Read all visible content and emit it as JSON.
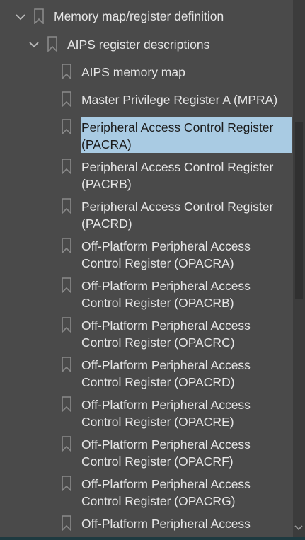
{
  "tree": {
    "level0": {
      "label": "Memory map/register definition",
      "icon": "bookmark-icon",
      "expand_icon": "chevron-down-icon"
    },
    "level1": {
      "label": "AIPS register descriptions",
      "icon": "bookmark-icon",
      "expand_icon": "chevron-down-icon"
    },
    "items": [
      {
        "line1": "AIPS memory map",
        "line2": ""
      },
      {
        "line1": "Master Privilege Register A (MPRA)",
        "line2": ""
      },
      {
        "line1": "Peripheral Access Control Register",
        "line2": "(PACRA)",
        "selected": true
      },
      {
        "line1": "Peripheral Access Control Register",
        "line2": "(PACRB)"
      },
      {
        "line1": "Peripheral Access Control Register",
        "line2": "(PACRD)"
      },
      {
        "line1": "Off-Platform Peripheral Access",
        "line2": "Control Register (OPACRA)"
      },
      {
        "line1": "Off-Platform Peripheral Access",
        "line2": "Control Register (OPACRB)"
      },
      {
        "line1": "Off-Platform Peripheral Access",
        "line2": "Control Register (OPACRC)"
      },
      {
        "line1": "Off-Platform Peripheral Access",
        "line2": "Control Register (OPACRD)"
      },
      {
        "line1": "Off-Platform Peripheral Access",
        "line2": "Control Register (OPACRE)"
      },
      {
        "line1": "Off-Platform Peripheral Access",
        "line2": "Control Register (OPACRF)"
      },
      {
        "line1": "Off-Platform Peripheral Access",
        "line2": "Control Register (OPACRG)"
      },
      {
        "line1": "Off-Platform Peripheral Access",
        "line2": ""
      }
    ]
  },
  "colors": {
    "background": "#4a4a4a",
    "selection": "#a9cbe3",
    "text": "#e6e6e6",
    "selected_text": "#1c1c1c",
    "icon": "#8a8a8a"
  }
}
